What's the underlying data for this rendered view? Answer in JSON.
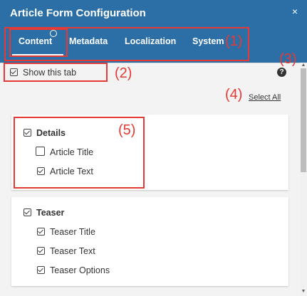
{
  "header": {
    "title": "Article Form Configuration",
    "close_symbol": "×",
    "tabs": [
      {
        "label": "Content",
        "active": true
      },
      {
        "label": "Metadata",
        "active": false
      },
      {
        "label": "Localization",
        "active": false
      },
      {
        "label": "System",
        "active": false
      }
    ],
    "active_tab": "Content"
  },
  "annotations": {
    "n1": "(1)",
    "n2": "(2)",
    "n3": "(3)",
    "n4": "(4)",
    "n5": "(5)"
  },
  "toolbar": {
    "show_tab_label": "Show this tab",
    "show_tab_checked": true,
    "help_symbol": "?",
    "select_all_label": "Select All"
  },
  "groups": [
    {
      "label": "Details",
      "checked": true,
      "fields": [
        {
          "label": "Article Title",
          "checked": false
        },
        {
          "label": "Article Text",
          "checked": true
        }
      ]
    },
    {
      "label": "Teaser",
      "checked": true,
      "fields": [
        {
          "label": "Teaser Title",
          "checked": true
        },
        {
          "label": "Teaser Text",
          "checked": true
        },
        {
          "label": "Teaser Options",
          "checked": true
        }
      ]
    }
  ],
  "colors": {
    "header_bg": "#2b6fa6",
    "annotation": "#e53935"
  }
}
